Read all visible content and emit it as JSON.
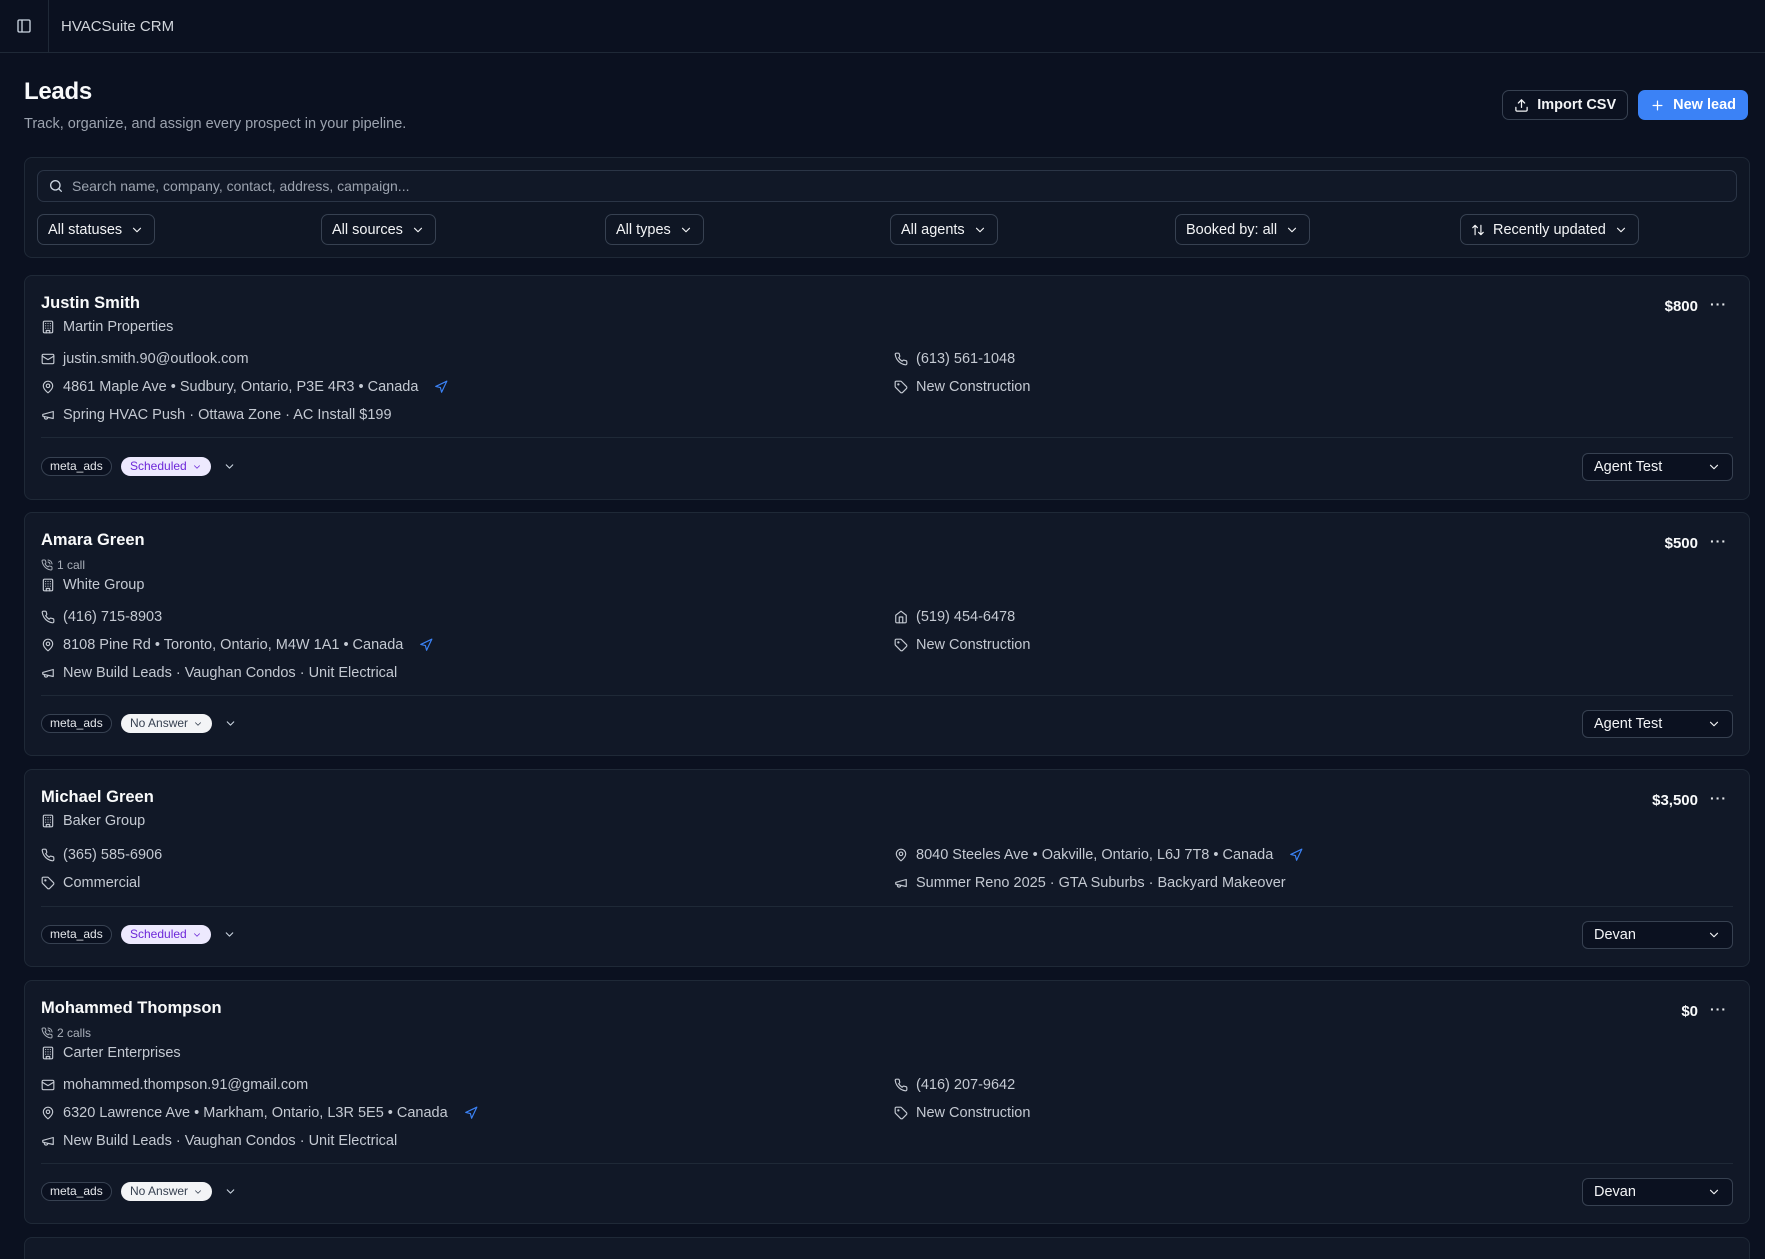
{
  "app": {
    "title": "HVACSuite CRM"
  },
  "header": {
    "title": "Leads",
    "subtitle": "Track, organize, and assign every prospect in your pipeline.",
    "import_label": "Import CSV",
    "new_lead_label": "New lead"
  },
  "filters": {
    "search_placeholder": "Search name, company, contact, address, campaign...",
    "status": "All statuses",
    "source": "All sources",
    "type": "All types",
    "agent": "All agents",
    "booked_by": "Booked by: all",
    "sort": "Recently updated"
  },
  "leads": [
    {
      "name": "Justin Smith",
      "amount": "$800",
      "company": "Martin Properties",
      "email": "justin.smith.90@outlook.com",
      "phone": "(613) 561-1048",
      "address": "4861 Maple Ave • Sudbury, Ontario, P3E 4R3 • Canada",
      "type": "New Construction",
      "campaign": "Spring HVAC Push · Ottawa Zone · AC Install $199",
      "source": "meta_ads",
      "status": "Scheduled",
      "agent": "Agent Test"
    },
    {
      "name": "Amara Green",
      "calls": "1 call",
      "amount": "$500",
      "company": "White Group",
      "phone": "(416) 715-8903",
      "home_phone": "(519) 454-6478",
      "address": "8108 Pine Rd • Toronto, Ontario, M4W 1A1 • Canada",
      "type": "New Construction",
      "campaign": "New Build Leads · Vaughan Condos · Unit Electrical",
      "source": "meta_ads",
      "status": "No Answer",
      "agent": "Agent Test"
    },
    {
      "name": "Michael Green",
      "amount": "$3,500",
      "company": "Baker Group",
      "phone": "(365) 585-6906",
      "address": "8040 Steeles Ave • Oakville, Ontario, L6J 7T8 • Canada",
      "type": "Commercial",
      "campaign": "Summer Reno 2025 · GTA Suburbs · Backyard Makeover",
      "source": "meta_ads",
      "status": "Scheduled",
      "agent": "Devan"
    },
    {
      "name": "Mohammed Thompson",
      "calls": "2 calls",
      "amount": "$0",
      "company": "Carter Enterprises",
      "email": "mohammed.thompson.91@gmail.com",
      "phone": "(416) 207-9642",
      "address": "6320 Lawrence Ave • Markham, Ontario, L3R 5E5 • Canada",
      "type": "New Construction",
      "campaign": "New Build Leads · Vaughan Condos · Unit Electrical",
      "source": "meta_ads",
      "status": "No Answer",
      "agent": "Devan"
    }
  ],
  "colors": {
    "background": "#0b1120",
    "card": "#111827",
    "accent": "#3b82f6",
    "scheduled_bg": "#ede9fe",
    "scheduled_text": "#6d28d9",
    "noanswer_bg": "#f3f4f6"
  }
}
